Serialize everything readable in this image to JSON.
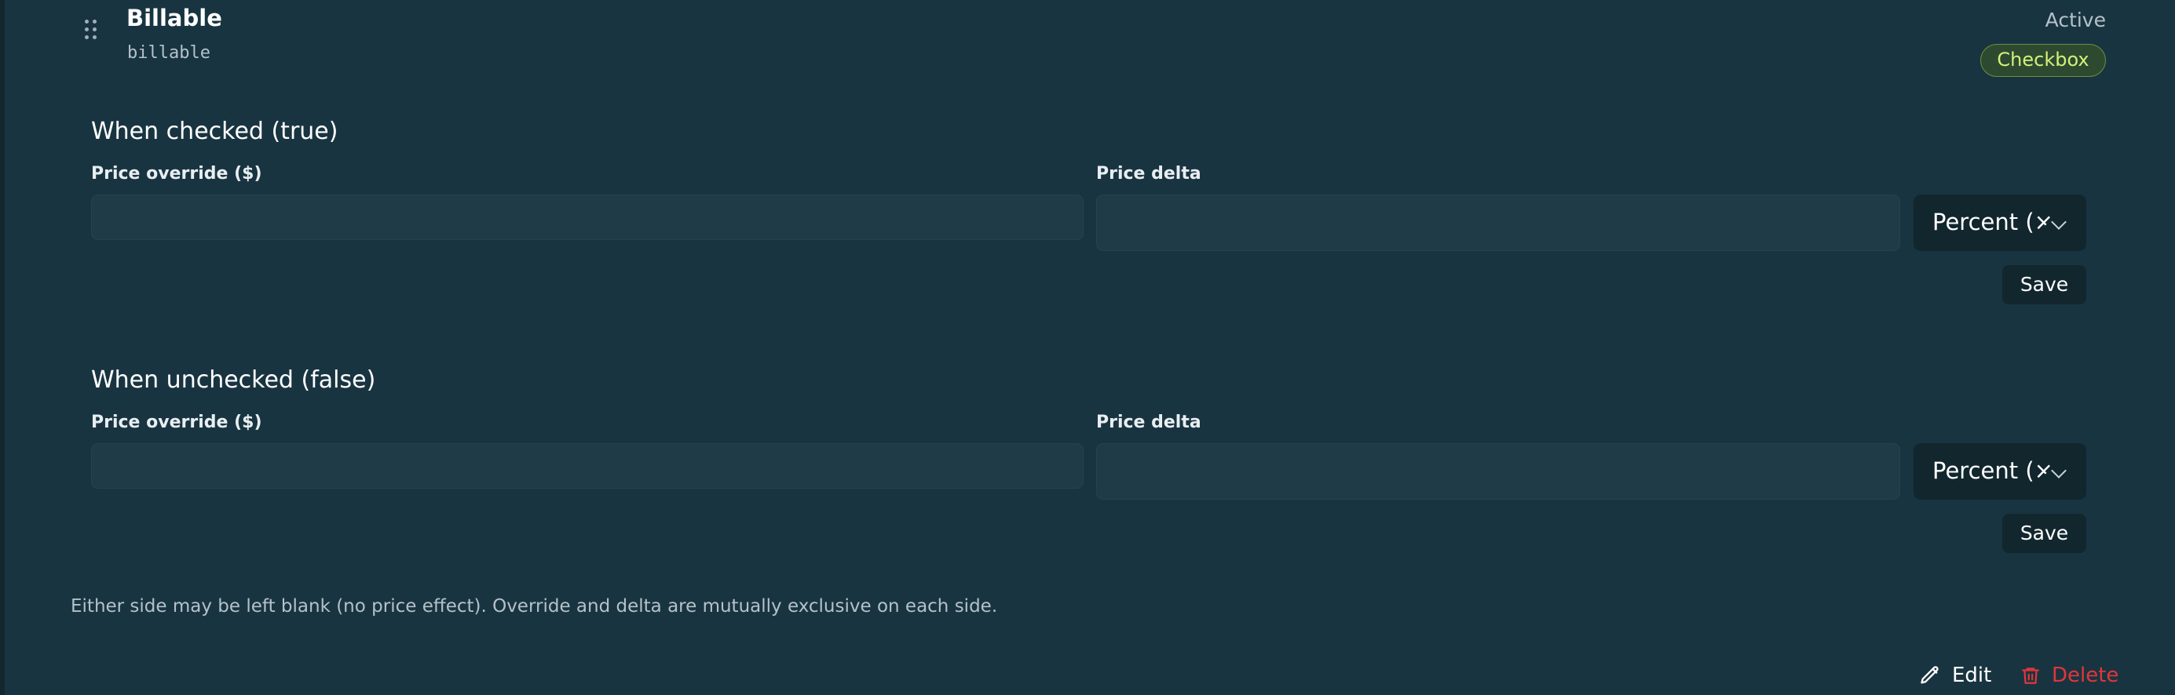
{
  "field": {
    "name": "Billable",
    "key": "billable",
    "status": "Active",
    "type": "Checkbox"
  },
  "sections": [
    {
      "title": "When checked (true)",
      "price_override_label": "Price override ($)",
      "price_override_value": "",
      "price_delta_label": "Price delta",
      "price_delta_value": "",
      "delta_mode": "Percent (×",
      "save_label": "Save"
    },
    {
      "title": "When unchecked (false)",
      "price_override_label": "Price override ($)",
      "price_override_value": "",
      "price_delta_label": "Price delta",
      "price_delta_value": "",
      "delta_mode": "Percent (×",
      "save_label": "Save"
    }
  ],
  "helper_text": "Either side may be left blank (no price effect). Override and delta are mutually exclusive on each side.",
  "actions": {
    "edit_label": "Edit",
    "delete_label": "Delete",
    "edit_icon": "pencil-icon",
    "delete_icon": "trash-icon"
  },
  "colors": {
    "background": "#193441",
    "badge_text": "#d4f07a",
    "delete": "#e0363b"
  }
}
